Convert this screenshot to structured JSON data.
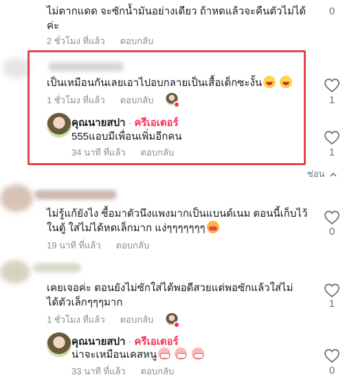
{
  "comments": [
    {
      "text_line1": "ไม่ตากแดด จะซักน้ำมันอย่างเดียว ถ้าหดแล้วจะคืนตัวไม่ได้",
      "text_line2": "ค่ะ",
      "time": "2 ชั่วโมง ที่แล้ว",
      "reply_label": "ตอบกลับ",
      "likes": "0"
    },
    {
      "text": "เป็นเหมือนกันเลยเอาไปอบกลายเป็นเสื้อเด็กซะงั้น",
      "time": "1 ชั่วโมง ที่แล้ว",
      "reply_label": "ตอบกลับ",
      "likes": "1",
      "reply": {
        "author": "คุณนายสปา",
        "creator_label": "ครีเอเตอร์",
        "text": "555แอบมีเพื่อนเพิ่มอีกคน",
        "time": "34 นาที ที่แล้ว",
        "reply_label": "ตอบกลับ",
        "likes": "1"
      }
    },
    {
      "text_line1": "ไม่รู้แก้ยังไง ซื้อมาตัวนึงแพงมากเป็นแบนด์เนม ตอนนี้เก็บไว้",
      "text_line2": "ในตู้ ใส่ไม่ได้หดเล็กมาก แง่ๆๆๆๆๆๆๆ",
      "time": "19 นาที ที่แล้ว",
      "reply_label": "ตอบกลับ",
      "likes": "0"
    },
    {
      "text_line1": "เคยเจอค่ะ ตอนยังไม่ซักใส่ได้พอดีสวยแต่พอซักแล้วใส่ไม่",
      "text_line2": "ได้ตัวเล็กๆๆๆมาก",
      "time": "1 ชั่วโมง ที่แล้ว",
      "reply_label": "ตอบกลับ",
      "likes": "1",
      "reply": {
        "author": "คุณนายสปา",
        "creator_label": "ครีเอเตอร์",
        "text": "น่าจะเหมือนเคสหนู",
        "time": "33 นาที ที่แล้ว",
        "reply_label": "ตอบกลับ",
        "likes": "0"
      }
    }
  ],
  "hide_replies_label": "ซ่อน",
  "colors": {
    "accent_creator": "#fe2c55",
    "highlight_border": "#e8424a",
    "muted": "#8a8b91"
  },
  "icons": {
    "like": "heart-outline-icon",
    "collapse": "chevron-up-icon"
  }
}
